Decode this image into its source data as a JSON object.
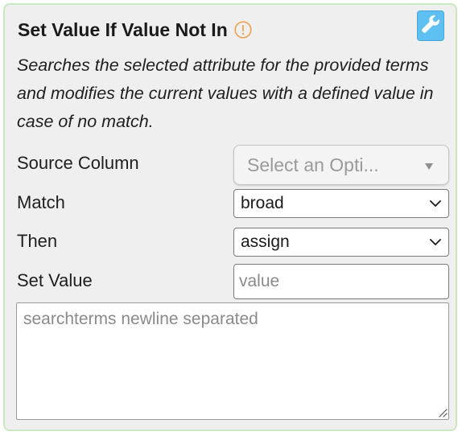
{
  "card": {
    "title": "Set Value If Value Not In",
    "description": "Searches the selected attribute for the provided terms and modifies the current values with a defined value in case of no match."
  },
  "fields": {
    "source_column": {
      "label": "Source Column",
      "placeholder": "Select an Opti..."
    },
    "match": {
      "label": "Match",
      "value": "broad"
    },
    "then": {
      "label": "Then",
      "value": "assign"
    },
    "set_value": {
      "label": "Set Value",
      "placeholder": "value"
    },
    "searchterms": {
      "placeholder": "searchterms newline separated"
    }
  },
  "icons": {
    "warning": "exclamation-circle-icon",
    "settings": "wrench-icon",
    "dropdown": "chevron-down-icon",
    "resize": "resize-grip-icon"
  },
  "colors": {
    "card_border": "#c9e8c2",
    "warning": "#f0a050",
    "settings_button": "#5ec0f0"
  }
}
